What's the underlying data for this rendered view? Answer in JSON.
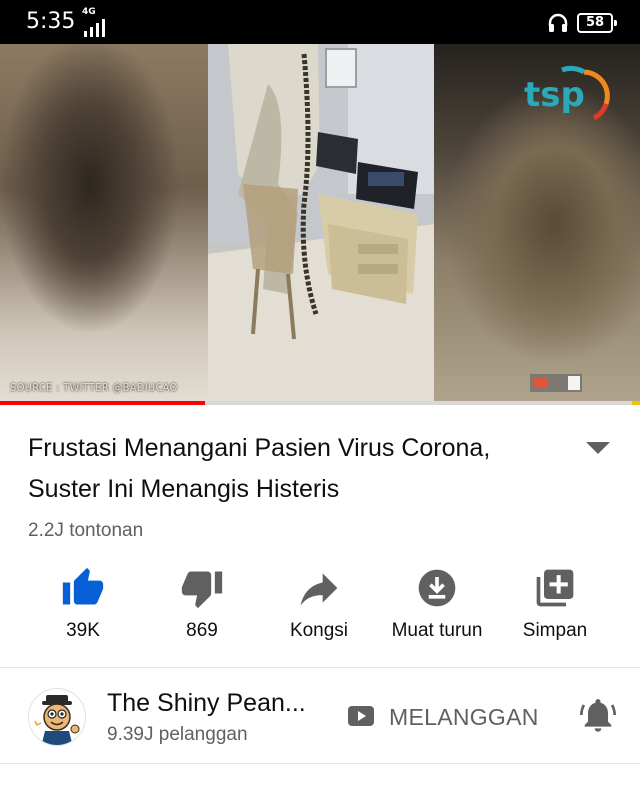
{
  "status_bar": {
    "time": "5:35",
    "network": "4G",
    "battery": "58"
  },
  "video": {
    "source_credit": "SOURCE : TWITTER @BADIUCAO",
    "channel_logo_text": "tsp",
    "progress_fraction": 0.32
  },
  "title": "Frustasi Menangani Pasien Virus Corona, Suster Ini Menangis Histeris",
  "views": "2.2J tontonan",
  "actions": {
    "like": {
      "label": "39K",
      "icon": "thumb-up-icon"
    },
    "dislike": {
      "label": "869",
      "icon": "thumb-down-icon"
    },
    "share": {
      "label": "Kongsi",
      "icon": "share-icon"
    },
    "download": {
      "label": "Muat turun",
      "icon": "download-icon"
    },
    "save": {
      "label": "Simpan",
      "icon": "playlist-add-icon"
    }
  },
  "channel": {
    "name": "The Shiny Pean...",
    "subscribers": "9.39J pelanggan",
    "subscribe_label": "MELANGGAN"
  },
  "colors": {
    "accent_blue": "#065fd4",
    "progress_red": "#ff0000",
    "icon_gray": "#606060",
    "text_primary": "#0f0f0f",
    "text_secondary": "#606060"
  }
}
